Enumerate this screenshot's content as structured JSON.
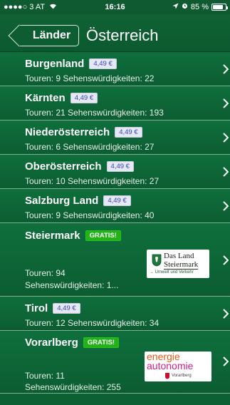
{
  "status": {
    "carrier": "●●●●○ 3 AT",
    "wifi": "wifi-icon",
    "time": "16:16",
    "location": "location-arrow-icon",
    "alarm": "alarm-icon",
    "battery_text": "85 %",
    "battery_level": 0.85
  },
  "nav": {
    "back_label": "Länder",
    "title": "Österreich"
  },
  "items": [
    {
      "name": "Burgenland",
      "badge": "4,49 €",
      "sub": "Touren: 9  Sehenswürdigkeiten: 22"
    },
    {
      "name": "Kärnten",
      "badge": "4,49 €",
      "sub": "Touren: 21  Sehenswürdigkeiten: 193"
    },
    {
      "name": "Niederösterreich",
      "badge": "4,49 €",
      "sub": "Touren: 6  Sehenswürdigkeiten: 27"
    },
    {
      "name": "Oberösterreich",
      "badge": "4,49 €",
      "sub": "Touren: 10  Sehenswürdigkeiten: 27"
    },
    {
      "name": "Salzburg Land",
      "badge": "4,49 €",
      "sub": "Touren: 9  Sehenswürdigkeiten: 40"
    },
    {
      "name": "Steiermark",
      "badge": "GRATIS!",
      "sub1": "Touren: 94",
      "sub2": "Sehenswürdigkeiten: 1...",
      "logo_line1": "Das Land",
      "logo_line2": "Steiermark",
      "logo_line3": "→ Umwelt und Verkehr"
    },
    {
      "name": "Tirol",
      "badge": "4,49 €",
      "sub": "Touren: 12  Sehenswürdigkeiten: 34"
    },
    {
      "name": "Vorarlberg",
      "badge": "GRATIS!",
      "sub1": "Touren: 11",
      "sub2": "Sehenswürdigkeiten: 255",
      "logo_line1": "energie",
      "logo_line2": "autonomie",
      "logo_line3": "Vorarlberg"
    }
  ],
  "colors": {
    "background": "#0d5f34",
    "badge_price_bg": "#e6e8f5",
    "badge_price_text": "#3a46b8",
    "badge_free_bg": "#22b318"
  }
}
